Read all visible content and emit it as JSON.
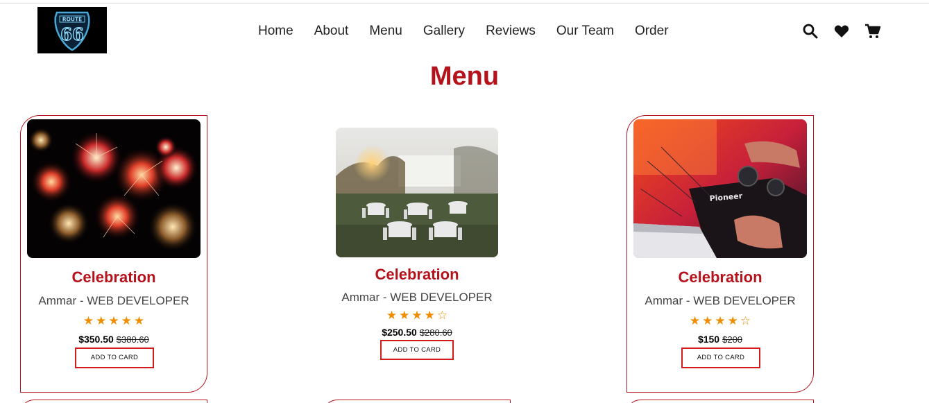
{
  "header": {
    "logo_alt": "Route 66",
    "nav": [
      "Home",
      "About",
      "Menu",
      "Gallery",
      "Reviews",
      "Our Team",
      "Order"
    ],
    "icons": [
      "search-icon",
      "heart-icon",
      "cart-icon"
    ]
  },
  "section": {
    "title": "Menu"
  },
  "colors": {
    "accent": "#b5121b",
    "star": "#f08c00",
    "button_border": "#d11a1a"
  },
  "cards": [
    {
      "title": "Celebration",
      "subtitle": "Ammar - WEB DEVELOPER",
      "rating": 5,
      "max_rating": 5,
      "price": "$350.50",
      "old_price": "$380.60",
      "button": "ADD TO CARD",
      "image": "fireworks"
    },
    {
      "title": "Celebration",
      "subtitle": "Ammar - WEB DEVELOPER",
      "rating": 4,
      "max_rating": 5,
      "price": "$250.50",
      "old_price": "$280.60",
      "button": "ADD TO CARD",
      "image": "wedding-tables"
    },
    {
      "title": "Celebration",
      "subtitle": "Ammar - WEB DEVELOPER",
      "rating": 4,
      "max_rating": 5,
      "price": "$150",
      "old_price": "$200",
      "button": "ADD TO CARD",
      "image": "dj-mixer"
    }
  ]
}
